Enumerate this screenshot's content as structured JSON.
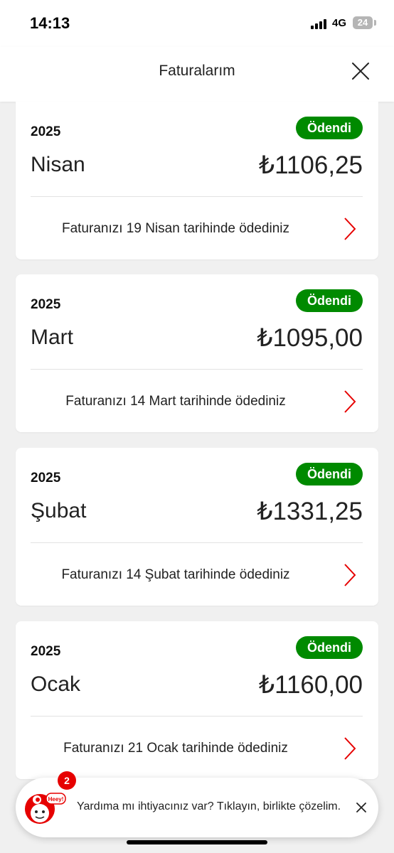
{
  "status_bar": {
    "time": "14:13",
    "network": "4G",
    "battery": "24"
  },
  "header": {
    "title": "Faturalarım",
    "close_icon": "close-icon"
  },
  "invoices": [
    {
      "year": "2025",
      "status": "Ödendi",
      "month": "Nisan",
      "amount": "₺1106,25",
      "payment_note": "Faturanızı 19 Nisan tarihinde ödediniz"
    },
    {
      "year": "2025",
      "status": "Ödendi",
      "month": "Mart",
      "amount": "₺1095,00",
      "payment_note": "Faturanızı 14 Mart tarihinde ödediniz"
    },
    {
      "year": "2025",
      "status": "Ödendi",
      "month": "Şubat",
      "amount": "₺1331,25",
      "payment_note": "Faturanızı 14 Şubat tarihinde ödediniz"
    },
    {
      "year": "2025",
      "status": "Ödendi",
      "month": "Ocak",
      "amount": "₺1160,00",
      "payment_note": "Faturanızı 21 Ocak tarihinde ödediniz"
    }
  ],
  "help_banner": {
    "notification_count": "2",
    "mascot_label": "Heey!",
    "message": "Yardıma mı ihtiyacınız var? Tıklayın, birlikte çözelim."
  },
  "colors": {
    "paid_badge": "#008a00",
    "accent": "#e60000",
    "background": "#f0f0f0"
  }
}
